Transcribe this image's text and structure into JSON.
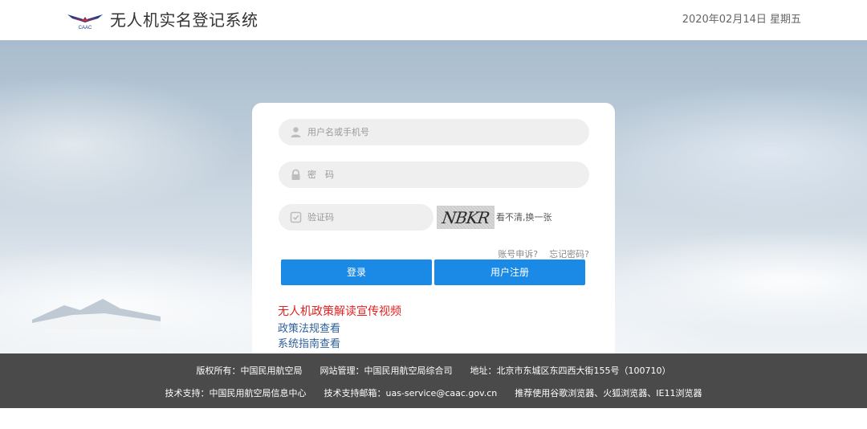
{
  "header": {
    "logo_text": "CAAC",
    "title": "无人机实名登记系统",
    "date": "2020年02月14日 星期五"
  },
  "login": {
    "username_placeholder": "用户名或手机号",
    "password_placeholder": "密　码",
    "captcha_placeholder": "验证码",
    "captcha_code": "NBKR",
    "captcha_refresh": "看不清,换一张",
    "appeal_link": "账号申诉?",
    "forgot_link": "忘记密码?",
    "login_button": "登录",
    "register_button": "用户注册"
  },
  "links": {
    "promo_video": "无人机政策解读宣传视频",
    "policy": "政策法规查看",
    "guide": "系统指南查看"
  },
  "footer": {
    "copyright": "版权所有：中国民用航空局",
    "site_admin": "网站管理：中国民用航空局综合司",
    "address": "地址：北京市东城区东四西大街155号（100710）",
    "tech_support": "技术支持：中国民用航空局信息中心",
    "support_email": "技术支持邮箱：uas-service@caac.gov.cn",
    "browser_tip": "推荐使用谷歌浏览器、火狐浏览器、IE11浏览器"
  },
  "icons": {
    "logo": "caac-wings-logo",
    "username": "user-icon",
    "password": "lock-icon",
    "captcha": "shield-check-icon"
  },
  "colors": {
    "primary_button": "#1b8ae6",
    "promo_link": "#e02020",
    "link": "#2d5f9a",
    "footer_bg": "#4a4a4a"
  }
}
